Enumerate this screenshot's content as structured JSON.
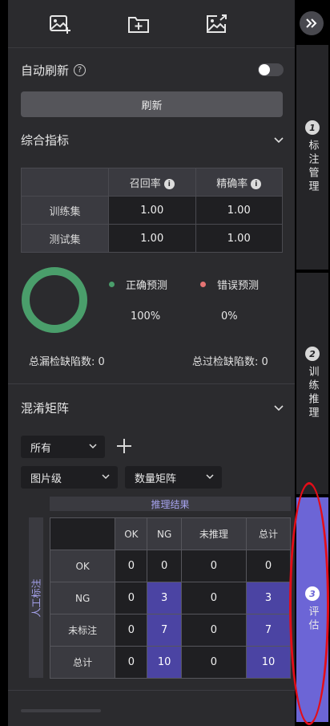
{
  "toolbar": {
    "icons": [
      "image-add-icon",
      "folder-add-icon",
      "image-export-icon"
    ]
  },
  "auto_refresh": {
    "label": "自动刷新",
    "help_glyph": "?",
    "enabled": false
  },
  "refresh_button": {
    "label": "刷新"
  },
  "metrics_section": {
    "title": "综合指标",
    "columns": [
      "召回率",
      "精确率"
    ],
    "rows": [
      {
        "label": "训练集",
        "recall": "1.00",
        "precision": "1.00"
      },
      {
        "label": "测试集",
        "recall": "1.00",
        "precision": "1.00"
      }
    ],
    "correct_label": "正确预测",
    "error_label": "错误预测",
    "correct_pct": "100%",
    "error_pct": "0%",
    "correct_color": "#4a9e6b",
    "error_color": "#e57373",
    "missed_label": "总漏检缺陷数:",
    "missed_value": "0",
    "over_label": "总过检缺陷数:",
    "over_value": "0"
  },
  "confusion_section": {
    "title": "混淆矩阵",
    "filter_value": "所有",
    "level_value": "图片级",
    "matrix_type_value": "数量矩阵",
    "infer_header": "推理结果",
    "manual_label": "人工标注",
    "columns": [
      "OK",
      "NG",
      "未推理",
      "总计"
    ],
    "rows": [
      {
        "label": "OK",
        "values": [
          "0",
          "0",
          "0",
          "0"
        ]
      },
      {
        "label": "NG",
        "values": [
          "0",
          "3",
          "0",
          "3"
        ]
      },
      {
        "label": "未标注",
        "values": [
          "0",
          "7",
          "0",
          "7"
        ]
      },
      {
        "label": "总计",
        "values": [
          "0",
          "10",
          "0",
          "10"
        ]
      }
    ],
    "highlight_color": "#4b44a3"
  },
  "side_tabs": [
    {
      "num": "1",
      "label": "标注管理",
      "active": false
    },
    {
      "num": "2",
      "label": "训练推理",
      "active": false
    },
    {
      "num": "3",
      "label": "评估",
      "active": true
    }
  ],
  "accent_color": "#6c65d6"
}
